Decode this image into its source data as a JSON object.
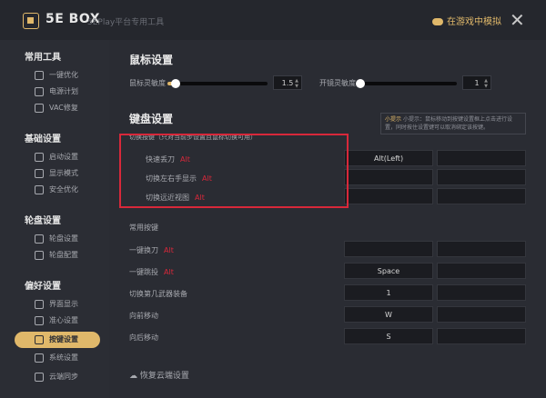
{
  "app": {
    "name": "5E BOX",
    "subtitle": "5EPlay平台专用工具"
  },
  "header": {
    "game_button": "在游戏中模拟"
  },
  "sidebar": {
    "groups": [
      {
        "title": "常用工具",
        "items": [
          "一键优化",
          "电源计划",
          "VAC修复"
        ]
      },
      {
        "title": "基础设置",
        "items": [
          "启动设置",
          "显示模式",
          "安全优化"
        ]
      },
      {
        "title": "轮盘设置",
        "items": [
          "轮盘设置",
          "轮盘配置"
        ]
      },
      {
        "title": "偏好设置",
        "items": [
          "界面显示",
          "准心设置",
          "按键设置",
          "系统设置",
          "云端同步"
        ]
      }
    ],
    "active": "按键设置"
  },
  "mouse": {
    "title": "鼠标设置",
    "sens_label": "鼠标灵敏度",
    "sens_value": "1.5",
    "sens_level": 0.08,
    "zoom_label": "开镜灵敏度",
    "zoom_value": "1",
    "zoom_level": 0.02
  },
  "keyboard": {
    "title": "键盘设置",
    "tip": "小提示：鼠标移动到按键设置框上点击进行设置，同时按住设置键可以取消绑定该按键。",
    "tip_hl": "小提示",
    "group_label": "切换按键（只对当前步设置且鼠标切换可用）",
    "rows": [
      {
        "label": "快速丢刀",
        "tag": "Alt",
        "key": "Alt(Left)"
      },
      {
        "label": "切换左右手显示",
        "tag": "Alt",
        "key": ""
      },
      {
        "label": "切换远近视图",
        "tag": "Alt",
        "key": ""
      }
    ],
    "common_label": "常用按键",
    "common_rows": [
      {
        "label": "一键换刀",
        "tag": "Alt",
        "key": ""
      },
      {
        "label": "一键跳投",
        "tag": "Alt",
        "key": "Space"
      },
      {
        "label": "切换第几武器装备",
        "tag": "",
        "key": "1"
      },
      {
        "label": "向前移动",
        "tag": "",
        "key": "W"
      },
      {
        "label": "向后移动",
        "tag": "",
        "key": "S"
      }
    ]
  },
  "footer": {
    "cloud": "恢复云端设置"
  }
}
